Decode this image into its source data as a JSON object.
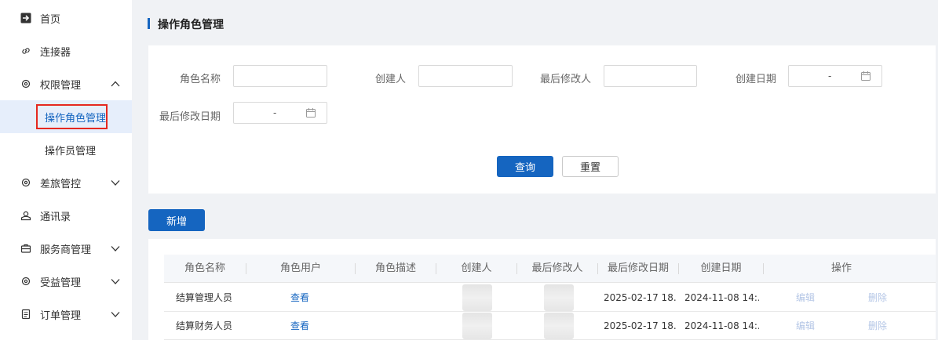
{
  "sidebar": {
    "items": [
      {
        "label": "首页",
        "icon": "plane-icon"
      },
      {
        "label": "连接器",
        "icon": "link-icon"
      },
      {
        "label": "权限管理",
        "icon": "gear-icon",
        "expanded": true
      },
      {
        "label": "差旅管控",
        "icon": "gear-icon",
        "expanded": false
      },
      {
        "label": "通讯录",
        "icon": "contacts-icon"
      },
      {
        "label": "服务商管理",
        "icon": "briefcase-icon",
        "expanded": false
      },
      {
        "label": "受益管理",
        "icon": "gear-icon",
        "expanded": false
      },
      {
        "label": "订单管理",
        "icon": "document-icon",
        "expanded": false
      }
    ],
    "sub_items": [
      {
        "label": "操作角色管理",
        "active": true
      },
      {
        "label": "操作员管理",
        "active": false
      }
    ]
  },
  "header": {
    "title": "操作角色管理"
  },
  "filters": {
    "role_name_label": "角色名称",
    "role_name_value": "",
    "creator_label": "创建人",
    "creator_value": "",
    "last_modifier_label": "最后修改人",
    "last_modifier_value": "",
    "create_date_label": "创建日期",
    "create_date_separator": "-",
    "last_modified_date_label": "最后修改日期",
    "last_modified_date_separator": "-",
    "query_label": "查询",
    "reset_label": "重置"
  },
  "actions": {
    "add_label": "新增"
  },
  "table": {
    "columns": [
      "角色名称",
      "角色用户",
      "角色描述",
      "创建人",
      "最后修改人",
      "最后修改日期",
      "创建日期",
      "操作"
    ],
    "rows": [
      {
        "role_name": "结算管理人员",
        "users_link": "查看",
        "description": "",
        "last_modified": "2025-02-17 18...",
        "created": "2024-11-08 14:...",
        "edit": "编辑",
        "delete": "删除"
      },
      {
        "role_name": "结算财务人员",
        "users_link": "查看",
        "description": "",
        "last_modified": "2025-02-17 18...",
        "created": "2024-11-08 14:...",
        "edit": "编辑",
        "delete": "删除"
      }
    ]
  },
  "colors": {
    "accent": "#1565c0",
    "highlight_border": "#e5281f",
    "disabled_link": "#b4c6e6"
  }
}
